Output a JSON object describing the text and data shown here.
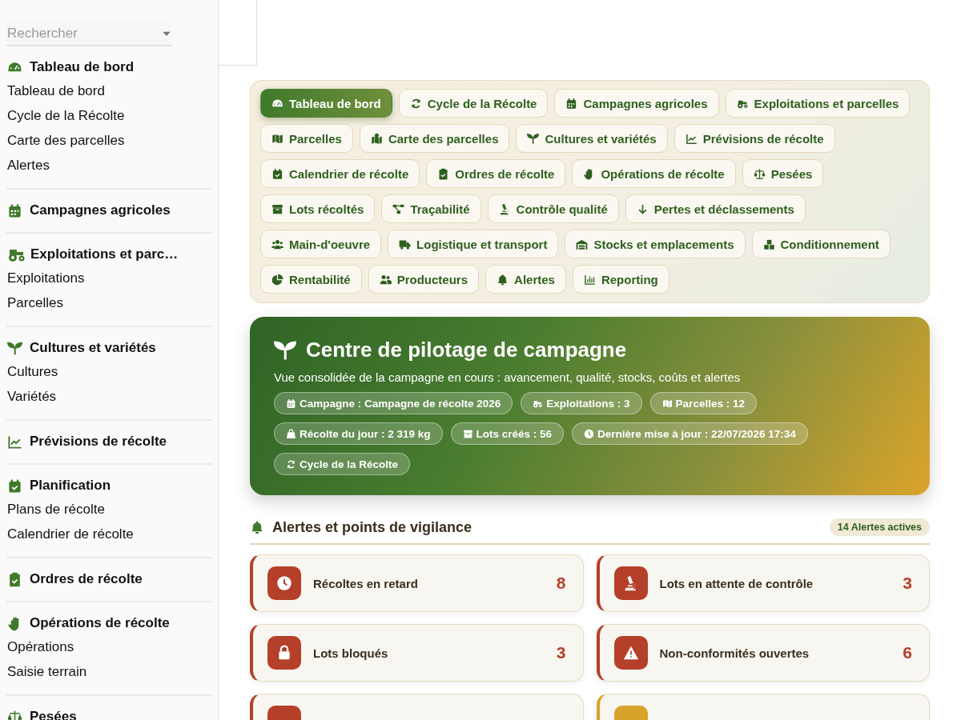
{
  "sidebar": {
    "search": {
      "placeholder": "Rechercher"
    },
    "sections": [
      {
        "title": "Tableau de bord",
        "items": [
          "Tableau de bord",
          "Cycle de la Récolte",
          "Carte des parcelles",
          "Alertes"
        ]
      },
      {
        "title": "Campagnes agricoles"
      },
      {
        "title": "Exploitations et parc…",
        "items": [
          "Exploitations",
          "Parcelles"
        ]
      },
      {
        "title": "Cultures et variétés",
        "items": [
          "Cultures",
          "Variétés"
        ]
      },
      {
        "title": "Prévisions de récolte"
      },
      {
        "title": "Planification",
        "items": [
          "Plans de récolte",
          "Calendrier de récolte"
        ]
      },
      {
        "title": "Ordres de récolte"
      },
      {
        "title": "Opérations de récolte",
        "items": [
          "Opérations",
          "Saisie terrain"
        ]
      },
      {
        "title": "Pesées"
      }
    ]
  },
  "nav_tabs": [
    {
      "label": "Tableau de bord",
      "selected": true
    },
    {
      "label": "Cycle de la Récolte",
      "selected": false
    },
    {
      "label": "Campagnes agricoles",
      "selected": false
    },
    {
      "label": "Exploitations et parcelles",
      "selected": false
    },
    {
      "label": "Parcelles",
      "selected": false
    },
    {
      "label": "Carte des parcelles",
      "selected": false
    },
    {
      "label": "Cultures et variétés",
      "selected": false
    },
    {
      "label": "Prévisions de récolte",
      "selected": false
    },
    {
      "label": "Calendrier de récolte",
      "selected": false
    },
    {
      "label": "Ordres de récolte",
      "selected": false
    },
    {
      "label": "Opérations de récolte",
      "selected": false
    },
    {
      "label": "Pesées",
      "selected": false
    },
    {
      "label": "Lots récoltés",
      "selected": false
    },
    {
      "label": "Traçabilité",
      "selected": false
    },
    {
      "label": "Contrôle qualité",
      "selected": false
    },
    {
      "label": "Pertes et déclassements",
      "selected": false
    },
    {
      "label": "Main-d'oeuvre",
      "selected": false
    },
    {
      "label": "Logistique et transport",
      "selected": false
    },
    {
      "label": "Stocks et emplacements",
      "selected": false
    },
    {
      "label": "Conditionnement",
      "selected": false
    },
    {
      "label": "Rentabilité",
      "selected": false
    },
    {
      "label": "Producteurs",
      "selected": false
    },
    {
      "label": "Alertes",
      "selected": false
    },
    {
      "label": "Reporting",
      "selected": false
    }
  ],
  "hero": {
    "title": "Centre de pilotage de campagne",
    "subtitle": "Vue consolidée de la campagne en cours : avancement, qualité, stocks, coûts et alertes",
    "chips": [
      "Campagne : Campagne de récolte 2026",
      "Exploitations : 3",
      "Parcelles : 12",
      "Récolte du jour : 2 319 kg",
      "Lots créés : 56",
      "Dernière mise à jour : 22/07/2026 17:34",
      "Cycle de la Récolte"
    ]
  },
  "alerts": {
    "title": "Alertes et points de vigilance",
    "badge": "14 Alertes actives",
    "cards": [
      {
        "label": "Récoltes en retard",
        "count": "8",
        "color": "#b5402a"
      },
      {
        "label": "Lots en attente de contrôle",
        "count": "3",
        "color": "#b5402a"
      },
      {
        "label": "Lots bloqués",
        "count": "3",
        "color": "#b5402a"
      },
      {
        "label": "Non-conformités ouvertes",
        "count": "6",
        "color": "#b5402a"
      },
      {
        "color": "#b5402a"
      },
      {
        "color": "#d9a22a"
      }
    ]
  }
}
